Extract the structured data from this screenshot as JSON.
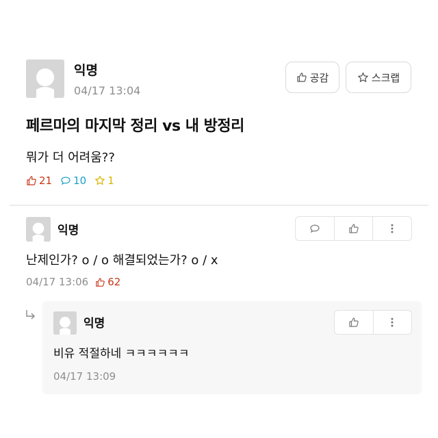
{
  "post": {
    "author": "익명",
    "time": "04/17 13:04",
    "like_button": "공감",
    "scrap_button": "스크랩",
    "title": "페르마의 마지막 정리 vs 내 방정리",
    "body": "뭐가 더 어려움??",
    "stats": {
      "likes": "21",
      "comments": "10",
      "scraps": "1"
    }
  },
  "comment": {
    "author": "익명",
    "text": "난제인가? o / o 해결되었는가? o / x",
    "time": "04/17 13:06",
    "likes": "62"
  },
  "reply": {
    "author": "익명",
    "text": "비유 적절하네 ㅋㅋㅋㅋㅋㅋ",
    "time": "04/17 13:09"
  },
  "colors": {
    "like": "#c5361a",
    "comment": "#1ba0c8",
    "scrap": "#d9b400",
    "muted": "#8d8d8d"
  },
  "icons": [
    "avatar-placeholder",
    "thumbs-up-icon",
    "star-icon",
    "speech-bubble-icon",
    "more-vertical-icon",
    "reply-arrow-icon"
  ]
}
